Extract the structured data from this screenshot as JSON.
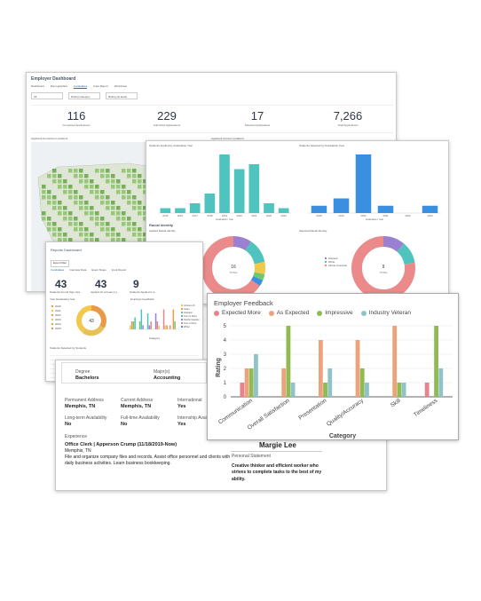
{
  "employer": {
    "title": "Employer Dashboard",
    "tabs": [
      "Dashboard",
      "Demographics",
      "Candidates",
      "Input Report",
      "Worksheet"
    ],
    "filters": [
      "All",
      "Rating Category",
      "Rating (at least)"
    ],
    "stats": [
      {
        "num": "116",
        "label": "Completed Applications"
      },
      {
        "num": "229",
        "label": "Submitted Applications"
      },
      {
        "num": "17",
        "label": "Selected Applications"
      },
      {
        "num": "7,266",
        "label": "Total Applications"
      }
    ],
    "map_label_left": "Applicant Hometown Locations",
    "map_label_right": "Applicant Current Locations"
  },
  "racial": {
    "left_header": "Students Applied by Graduation Year",
    "right_header": "Students Selected by Graduation Year",
    "section_title": "Racial Identity",
    "left_sub": "Applied Racial Identity",
    "right_sub": "Selected Racial Identity",
    "left_total": "16",
    "right_total": "9",
    "total_label": "TOTAL",
    "left_legend": [
      "Hispanic",
      "White",
      "African American",
      "Asian",
      "Two or More",
      "Not Reported"
    ],
    "right_legend": [
      "Hispanic",
      "White",
      "African American"
    ]
  },
  "reports": {
    "title": "Reports Dashboard",
    "filter": "Event Filter",
    "tabs": [
      "Candidates",
      "Interview Data",
      "Event Notes",
      "Input Report"
    ],
    "numbers": [
      {
        "num": "43",
        "label": "Students Found Sign Ups"
      },
      {
        "num": "43",
        "label": "Applied for at least 1 p..."
      },
      {
        "num": "9",
        "label": "Students Applied to 1..."
      }
    ],
    "donut_label": "Year Graduating Year",
    "donut_total": "43",
    "years": [
      "2020",
      "2021",
      "2022",
      "2023",
      "2024",
      "2025"
    ],
    "bar_title": "Employer Feedback",
    "bar_xlabel": "Category",
    "bar_legend": [
      "All Ever All",
      "Asian",
      "Hispanic",
      "Two Or More",
      "Pacific Islander",
      "Two or More",
      "White"
    ],
    "table_title": "Students Selected by Students"
  },
  "profile": {
    "degree_label": "Degree",
    "degree": "Bachelors",
    "major_label": "Major(s)",
    "major": "Accounting",
    "perm_label": "Permanent Address",
    "perm": "Memphis, TN",
    "current_label": "Current Address",
    "current": "Memphis, TN",
    "intl_label": "International",
    "intl": "Yes",
    "long_label": "Long-term Availability",
    "long": "No",
    "full_label": "Full-time Availability",
    "full": "No",
    "intern_label": "Internship Availability",
    "intern": "Yes",
    "exp_label": "Experience",
    "job": "Office Clerk | Apperson Crump (11/18/2019-Now)",
    "job_loc": "Memphis, TN",
    "job_desc": "File and organize company files and records. Assist office personnel and clients with daily business activities. Learn business bookkeeping.",
    "name": "Margie Lee",
    "stmt_label": "Personal Statement",
    "statement": "Creative thinker and efficient worker who strives to complete tasks to the best of my ability."
  },
  "feedback": {
    "title": "Employer Feedback",
    "colors": {
      "Expected More": "#e8838b",
      "As Expected": "#eba37c",
      "Impressive": "#8fbb52",
      "Industry Veteran": "#8fc3c7",
      "grid": "#e3e3e3",
      "axis": "#333333"
    }
  },
  "chart_data": [
    {
      "type": "bar",
      "title": "Employer Feedback",
      "xlabel": "Category",
      "ylabel": "Rating",
      "ylim": [
        0,
        5
      ],
      "yticks": [
        0,
        1,
        2,
        3,
        4,
        5
      ],
      "grid": true,
      "legend": "top",
      "categories": [
        "Communication",
        "Overall Satisfaction",
        "Presentation",
        "Quality/Accuracy",
        "Skill",
        "Timeliness"
      ],
      "series": [
        {
          "name": "Expected More",
          "color": "#e8838b",
          "values": [
            1,
            0,
            0,
            0,
            0,
            1
          ]
        },
        {
          "name": "As Expected",
          "color": "#eba37c",
          "values": [
            2,
            2,
            4,
            4,
            5,
            0
          ]
        },
        {
          "name": "Impressive",
          "color": "#8fbb52",
          "values": [
            2,
            5,
            1,
            2,
            1,
            5
          ]
        },
        {
          "name": "Industry Veteran",
          "color": "#8fc3c7",
          "values": [
            3,
            1,
            2,
            1,
            1,
            2
          ]
        }
      ]
    },
    {
      "type": "bar",
      "xlabel": "Graduation Year",
      "categories": [
        "2015",
        "2016",
        "2017",
        "2018",
        "2019",
        "2020",
        "2021",
        "2022",
        "2023"
      ],
      "values": [
        1,
        1,
        2,
        4,
        12,
        9,
        10,
        2,
        1
      ],
      "color": "#4fc3bd"
    },
    {
      "type": "bar",
      "xlabel": "Graduation Year",
      "categories": [
        "2018",
        "2019",
        "2020",
        "2021",
        "2022",
        "2023"
      ],
      "values": [
        1,
        2,
        8,
        1,
        0,
        1
      ],
      "color": "#3b8fe0"
    },
    {
      "type": "pie",
      "categories": [
        "Hispanic",
        "White",
        "African American",
        "Asian",
        "Two or More",
        "Not Reported"
      ],
      "values": [
        1.5,
        2,
        1,
        0.5,
        0.5,
        10.5
      ],
      "colors": [
        "#9b7fd1",
        "#4fc3bd",
        "#f0c94a",
        "#70c86e",
        "#3b8fe0",
        "#ea8a8a"
      ]
    },
    {
      "type": "pie",
      "categories": [
        "Hispanic",
        "White",
        "African American"
      ],
      "values": [
        1,
        1,
        7
      ],
      "colors": [
        "#9b7fd1",
        "#4fc3bd",
        "#ea8a8a"
      ]
    }
  ]
}
